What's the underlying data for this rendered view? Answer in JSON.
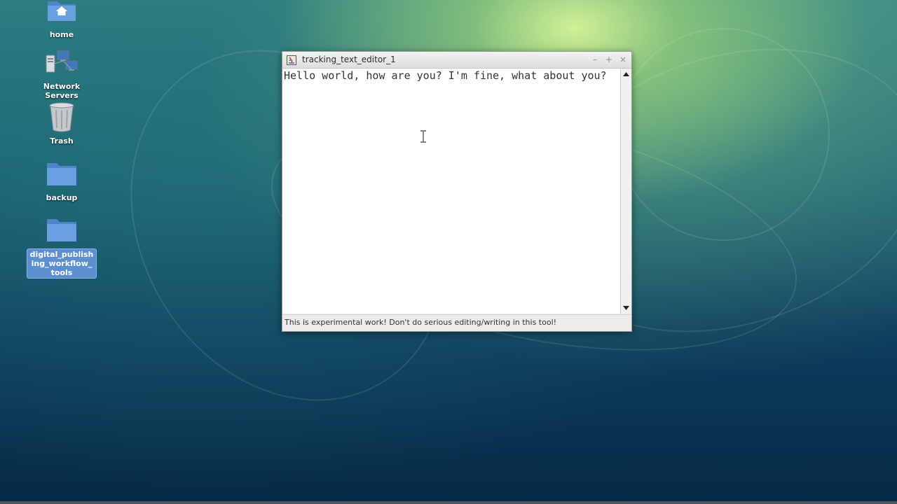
{
  "desktop": {
    "icons": [
      {
        "label": "home",
        "icon": "home-folder-icon"
      },
      {
        "label": "Network Servers",
        "icon": "network-servers-icon"
      },
      {
        "label": "Trash",
        "icon": "trash-icon"
      },
      {
        "label": "backup",
        "icon": "folder-icon"
      },
      {
        "label": "digital_publishing_workflow_tools",
        "icon": "folder-icon",
        "selected": true
      }
    ]
  },
  "window": {
    "title": "tracking_text_editor_1",
    "buttons": {
      "minimize": "–",
      "maximize": "+",
      "close": "×"
    },
    "editor_text": "Hello world, how are you? I'm fine, what about you?",
    "status": "This is experimental work! Don't do serious editing/writing in this tool!"
  },
  "colors": {
    "selection": "#5b8fd0",
    "folder": "#5a8fd0"
  }
}
